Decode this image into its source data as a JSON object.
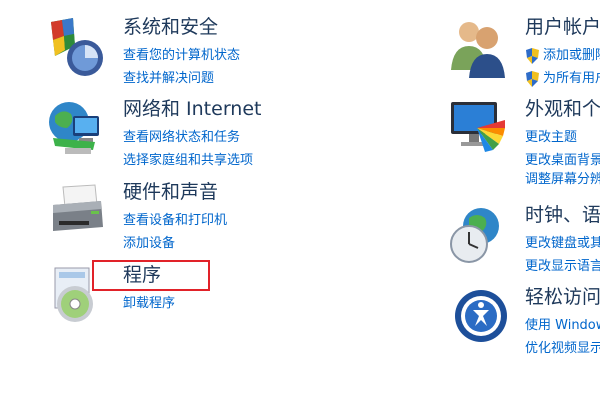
{
  "categories": {
    "system": {
      "title": "系统和安全",
      "links": [
        "查看您的计算机状态",
        "查找并解决问题"
      ]
    },
    "network": {
      "title": "网络和 Internet",
      "links": [
        "查看网络状态和任务",
        "选择家庭组和共享选项"
      ]
    },
    "hardware": {
      "title": "硬件和声音",
      "links": [
        "查看设备和打印机",
        "添加设备"
      ]
    },
    "programs": {
      "title": "程序",
      "links": [
        "卸载程序"
      ]
    },
    "users": {
      "title": "用户帐户和家庭安全",
      "links": [
        "添加或删除用户帐户",
        "为所有用户设置家长控制"
      ]
    },
    "appearance": {
      "title": "外观和个性化",
      "links": [
        "更改主题",
        "更改桌面背景",
        "调整屏幕分辨率"
      ]
    },
    "clock": {
      "title": "时钟、语言和区域",
      "links": [
        "更改键盘或其他输入法",
        "更改显示语言"
      ]
    },
    "ease": {
      "title": "轻松访问",
      "links": [
        "使用 Windows 建议的设置",
        "优化视频显示"
      ]
    }
  },
  "colors": {
    "title": "#1e395b",
    "link": "#0066cc",
    "highlight": "#e12229"
  },
  "icons": {
    "system": "shield-chart-icon",
    "network": "globe-monitor-icon",
    "hardware": "printer-icon",
    "programs": "program-disc-icon",
    "users": "users-icon",
    "appearance": "monitor-palette-icon",
    "clock": "clock-globe-icon",
    "ease": "ease-of-access-icon",
    "uac": "uac-shield-icon"
  }
}
